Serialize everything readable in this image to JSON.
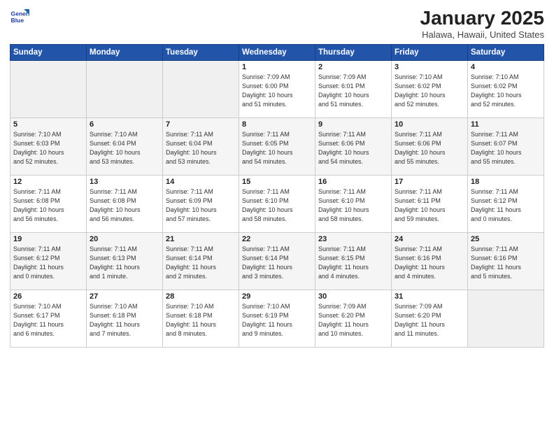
{
  "logo": {
    "line1": "General",
    "line2": "Blue"
  },
  "title": "January 2025",
  "subtitle": "Halawa, Hawaii, United States",
  "weekdays": [
    "Sunday",
    "Monday",
    "Tuesday",
    "Wednesday",
    "Thursday",
    "Friday",
    "Saturday"
  ],
  "weeks": [
    [
      {
        "day": "",
        "info": ""
      },
      {
        "day": "",
        "info": ""
      },
      {
        "day": "",
        "info": ""
      },
      {
        "day": "1",
        "info": "Sunrise: 7:09 AM\nSunset: 6:00 PM\nDaylight: 10 hours\nand 51 minutes."
      },
      {
        "day": "2",
        "info": "Sunrise: 7:09 AM\nSunset: 6:01 PM\nDaylight: 10 hours\nand 51 minutes."
      },
      {
        "day": "3",
        "info": "Sunrise: 7:10 AM\nSunset: 6:02 PM\nDaylight: 10 hours\nand 52 minutes."
      },
      {
        "day": "4",
        "info": "Sunrise: 7:10 AM\nSunset: 6:02 PM\nDaylight: 10 hours\nand 52 minutes."
      }
    ],
    [
      {
        "day": "5",
        "info": "Sunrise: 7:10 AM\nSunset: 6:03 PM\nDaylight: 10 hours\nand 52 minutes."
      },
      {
        "day": "6",
        "info": "Sunrise: 7:10 AM\nSunset: 6:04 PM\nDaylight: 10 hours\nand 53 minutes."
      },
      {
        "day": "7",
        "info": "Sunrise: 7:11 AM\nSunset: 6:04 PM\nDaylight: 10 hours\nand 53 minutes."
      },
      {
        "day": "8",
        "info": "Sunrise: 7:11 AM\nSunset: 6:05 PM\nDaylight: 10 hours\nand 54 minutes."
      },
      {
        "day": "9",
        "info": "Sunrise: 7:11 AM\nSunset: 6:06 PM\nDaylight: 10 hours\nand 54 minutes."
      },
      {
        "day": "10",
        "info": "Sunrise: 7:11 AM\nSunset: 6:06 PM\nDaylight: 10 hours\nand 55 minutes."
      },
      {
        "day": "11",
        "info": "Sunrise: 7:11 AM\nSunset: 6:07 PM\nDaylight: 10 hours\nand 55 minutes."
      }
    ],
    [
      {
        "day": "12",
        "info": "Sunrise: 7:11 AM\nSunset: 6:08 PM\nDaylight: 10 hours\nand 56 minutes."
      },
      {
        "day": "13",
        "info": "Sunrise: 7:11 AM\nSunset: 6:08 PM\nDaylight: 10 hours\nand 56 minutes."
      },
      {
        "day": "14",
        "info": "Sunrise: 7:11 AM\nSunset: 6:09 PM\nDaylight: 10 hours\nand 57 minutes."
      },
      {
        "day": "15",
        "info": "Sunrise: 7:11 AM\nSunset: 6:10 PM\nDaylight: 10 hours\nand 58 minutes."
      },
      {
        "day": "16",
        "info": "Sunrise: 7:11 AM\nSunset: 6:10 PM\nDaylight: 10 hours\nand 58 minutes."
      },
      {
        "day": "17",
        "info": "Sunrise: 7:11 AM\nSunset: 6:11 PM\nDaylight: 10 hours\nand 59 minutes."
      },
      {
        "day": "18",
        "info": "Sunrise: 7:11 AM\nSunset: 6:12 PM\nDaylight: 11 hours\nand 0 minutes."
      }
    ],
    [
      {
        "day": "19",
        "info": "Sunrise: 7:11 AM\nSunset: 6:12 PM\nDaylight: 11 hours\nand 0 minutes."
      },
      {
        "day": "20",
        "info": "Sunrise: 7:11 AM\nSunset: 6:13 PM\nDaylight: 11 hours\nand 1 minute."
      },
      {
        "day": "21",
        "info": "Sunrise: 7:11 AM\nSunset: 6:14 PM\nDaylight: 11 hours\nand 2 minutes."
      },
      {
        "day": "22",
        "info": "Sunrise: 7:11 AM\nSunset: 6:14 PM\nDaylight: 11 hours\nand 3 minutes."
      },
      {
        "day": "23",
        "info": "Sunrise: 7:11 AM\nSunset: 6:15 PM\nDaylight: 11 hours\nand 4 minutes."
      },
      {
        "day": "24",
        "info": "Sunrise: 7:11 AM\nSunset: 6:16 PM\nDaylight: 11 hours\nand 4 minutes."
      },
      {
        "day": "25",
        "info": "Sunrise: 7:11 AM\nSunset: 6:16 PM\nDaylight: 11 hours\nand 5 minutes."
      }
    ],
    [
      {
        "day": "26",
        "info": "Sunrise: 7:10 AM\nSunset: 6:17 PM\nDaylight: 11 hours\nand 6 minutes."
      },
      {
        "day": "27",
        "info": "Sunrise: 7:10 AM\nSunset: 6:18 PM\nDaylight: 11 hours\nand 7 minutes."
      },
      {
        "day": "28",
        "info": "Sunrise: 7:10 AM\nSunset: 6:18 PM\nDaylight: 11 hours\nand 8 minutes."
      },
      {
        "day": "29",
        "info": "Sunrise: 7:10 AM\nSunset: 6:19 PM\nDaylight: 11 hours\nand 9 minutes."
      },
      {
        "day": "30",
        "info": "Sunrise: 7:09 AM\nSunset: 6:20 PM\nDaylight: 11 hours\nand 10 minutes."
      },
      {
        "day": "31",
        "info": "Sunrise: 7:09 AM\nSunset: 6:20 PM\nDaylight: 11 hours\nand 11 minutes."
      },
      {
        "day": "",
        "info": ""
      }
    ]
  ]
}
